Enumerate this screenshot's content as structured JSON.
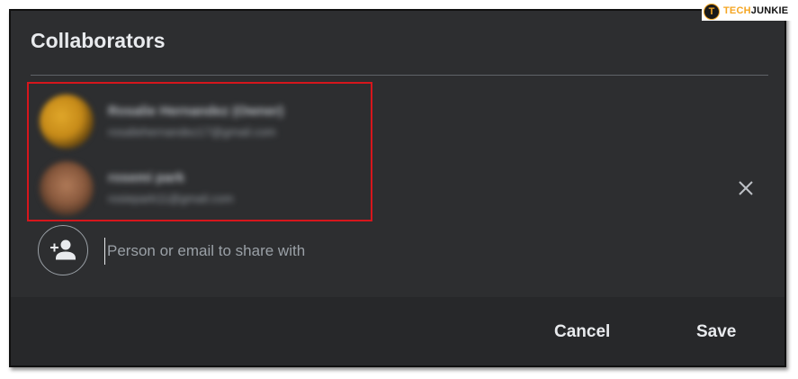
{
  "dialog": {
    "title": "Collaborators"
  },
  "collaborators": [
    {
      "name": "Rosalie Hernandez",
      "role": "(Owner)",
      "email": "rosaliehernandez17@gmail.com",
      "avatar": "avatar-photo"
    },
    {
      "name": "rosemi park",
      "role": "",
      "email": "rosiepark11@gmail.com",
      "avatar": "avatar-photo"
    }
  ],
  "share": {
    "placeholder": "Person or email to share with",
    "value": ""
  },
  "footer": {
    "cancel_label": "Cancel",
    "save_label": "Save"
  },
  "watermark": {
    "logo_letter": "T",
    "brand_first": "TECH",
    "brand_second": "JUNKIE"
  },
  "colors": {
    "dialog_bg": "#2d2e30",
    "footer_bg": "#27282a",
    "highlight_border": "#d6161c",
    "text_primary": "#e8eaed",
    "text_secondary": "#9aa0a6",
    "brand_accent": "#f5a623"
  },
  "icons": {
    "remove": "close-icon",
    "add_person": "person-add-icon"
  }
}
